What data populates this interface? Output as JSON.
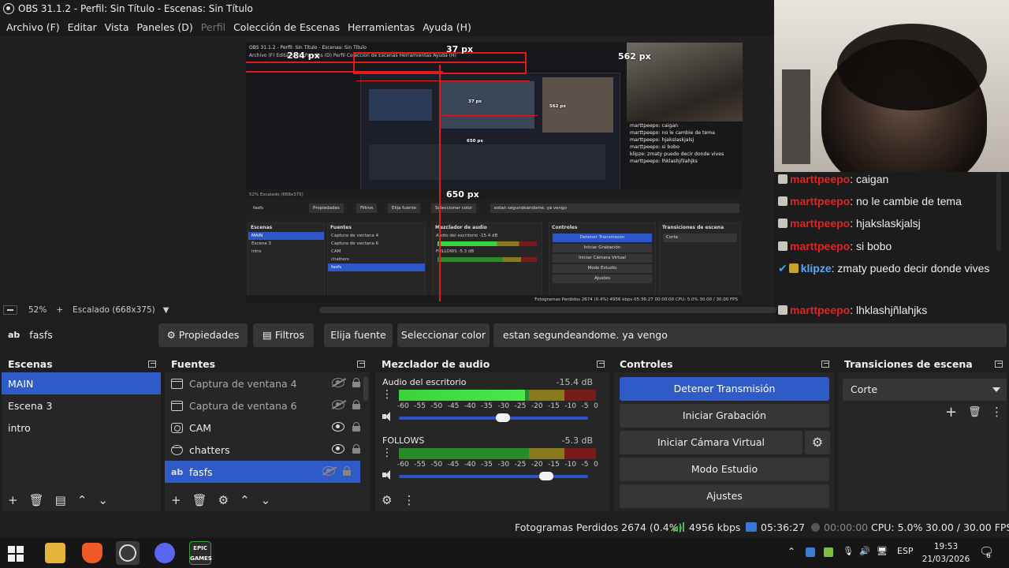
{
  "window": {
    "title": "OBS 31.1.2 - Perfil: Sin Título - Escenas: Sin Título"
  },
  "menu": [
    "Archivo (F)",
    "Editar",
    "Vista",
    "Paneles (D)",
    "Perfil",
    "Colección de Escenas",
    "Herramientas",
    "Ayuda (H)"
  ],
  "preview": {
    "guides": {
      "left": "284 px",
      "top": "37 px",
      "right": "562 px",
      "bottom": "650 px"
    },
    "zoom": "52%",
    "scale_label": "Escalado (668x375)"
  },
  "chat": [
    {
      "user": "marttpeepo",
      "message": ": caigan"
    },
    {
      "user": "marttpeepo",
      "message": ": no le cambie de tema"
    },
    {
      "user": "marttpeepo",
      "message": ": hjakslaskjalsj"
    },
    {
      "user": "marttpeepo",
      "message": ": si bobo"
    },
    {
      "user": "klipze",
      "message": ": zmaty puedo decir donde vives"
    },
    {
      "user": "marttpeepo",
      "message": ": lhklashjñlahjks"
    }
  ],
  "source_toolbar": {
    "source_name": "fasfs",
    "properties": "Propiedades",
    "filters": "Filtros",
    "choose_font": "Elija fuente",
    "select_color": "Seleccionar color",
    "text_value": "estan segundeandome. ya vengo"
  },
  "scenes": {
    "title": "Escenas",
    "items": [
      "MAIN",
      "Escena 3",
      "intro"
    ],
    "selected": "MAIN"
  },
  "sources": {
    "title": "Fuentes",
    "items": [
      {
        "name": "Captura de ventana 4",
        "type": "window-capture-icon",
        "visible": false
      },
      {
        "name": "Captura de ventana 6",
        "type": "window-capture-icon",
        "visible": false
      },
      {
        "name": "CAM",
        "type": "camera-icon",
        "visible": true
      },
      {
        "name": "chatters",
        "type": "browser-icon",
        "visible": true
      },
      {
        "name": "fasfs",
        "type": "text-icon",
        "visible": false
      }
    ]
  },
  "mixer": {
    "title": "Mezclador de audio",
    "scale": [
      "-60",
      "-55",
      "-50",
      "-45",
      "-40",
      "-35",
      "-30",
      "-25",
      "-20",
      "-15",
      "-10",
      "-5",
      "0"
    ],
    "channels": [
      {
        "name": "Audio del escritorio",
        "db": "-15.4 dB",
        "level": 0.64,
        "volume": 0.55
      },
      {
        "name": "FOLLOWS",
        "db": "-5.3 dB",
        "level": 0,
        "volume": 0.78
      }
    ]
  },
  "controls": {
    "title": "Controles",
    "stop_stream": "Detener Transmisión",
    "start_recording": "Iniciar Grabación",
    "start_virtual_cam": "Iniciar Cámara Virtual",
    "studio_mode": "Modo Estudio",
    "settings": "Ajustes"
  },
  "transitions": {
    "title": "Transiciones de escena",
    "selected": "Corte"
  },
  "status": {
    "dropped_frames": "Fotogramas Perdidos 2674 (0.4%)",
    "bitrate": "4956 kbps",
    "stream_time": "05:36:27",
    "rec_time": "00:00:00",
    "cpu": "CPU: 5.0%",
    "fps": "30.00 / 30.00 FPS"
  },
  "taskbar": {
    "lang": "ESP",
    "time": "19:53",
    "date": "21/03/2026",
    "notifications": "6",
    "epic_label": "EPIC GAMES"
  },
  "nested_preview": {
    "title": "OBS 31.1.2 - Perfil: Sin Título - Escenas: Sin Título",
    "menu": "Archivo (F)  Editar  Vista  Paneles (D)  Perfil  Colección de Escenas  Herramientas  Ayuda (H)",
    "toolbar": "52%   Escalado (668x375)",
    "source_buttons": [
      "fasfs",
      "Propiedades",
      "Filtros",
      "Elija fuente",
      "Seleccionar color",
      "estan segundeandome. ya vengo"
    ],
    "panels": [
      "Escenas",
      "Fuentes",
      "Mezclador de audio",
      "Controles",
      "Transiciones de escena"
    ],
    "scenes": [
      "MAIN",
      "Escena 3",
      "intro"
    ],
    "sources": [
      "Captura de ventana 4",
      "Captura de ventana 6",
      "CAM",
      "chatters",
      "fasfs"
    ],
    "mixer": [
      "Audio del escritorio  -15.4 dB",
      "FOLLOWS  -5.3 dB"
    ],
    "controls": [
      "Detener Transmisión",
      "Iniciar Grabación",
      "Iniciar Cámara Virtual",
      "Modo Estudio",
      "Ajustes"
    ],
    "transition": "Corte",
    "status": "Fotogramas Perdidos 2674 (0.4%)   4956 kbps   05:36:27   00:00:00   CPU: 5.0%   30.00 / 30.00 FPS",
    "inner_guides": {
      "top": "37 px",
      "right": "562 px",
      "bottom": "650 px"
    },
    "chat": [
      "marttpeepo: caigan",
      "marttpeepo: no le cambie de tema",
      "marttpeepo: hjakslaskjalsj",
      "marttpeepo: si bobo",
      "klipze: zmaty puedo decir donde vives",
      "marttpeepo: lhklashjñlahjks"
    ]
  }
}
